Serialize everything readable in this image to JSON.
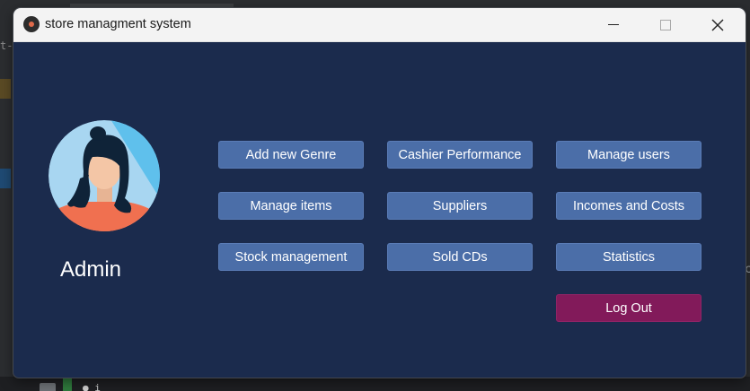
{
  "window": {
    "title": "store managment system"
  },
  "background": {
    "dash_text": "t-",
    "right_char": "c",
    "bottom_text": "● i"
  },
  "user": {
    "name": "Admin"
  },
  "buttons": {
    "add_genre": "Add new Genre",
    "cashier_performance": "Cashier Performance",
    "manage_users": "Manage users",
    "manage_items": "Manage items",
    "suppliers": "Suppliers",
    "incomes_costs": "Incomes and Costs",
    "stock_management": "Stock management",
    "sold_cds": "Sold CDs",
    "statistics": "Statistics",
    "log_out": "Log Out"
  },
  "icons": {
    "app": "app-icon",
    "minimize": "minimize-icon",
    "maximize": "maximize-icon",
    "close": "close-icon",
    "avatar": "user-avatar-icon"
  },
  "colors": {
    "window_bg": "#1b2b4d",
    "button_bg": "#4b6ea8",
    "logout_bg": "#821a5a",
    "titlebar_bg": "#f3f3f3"
  }
}
